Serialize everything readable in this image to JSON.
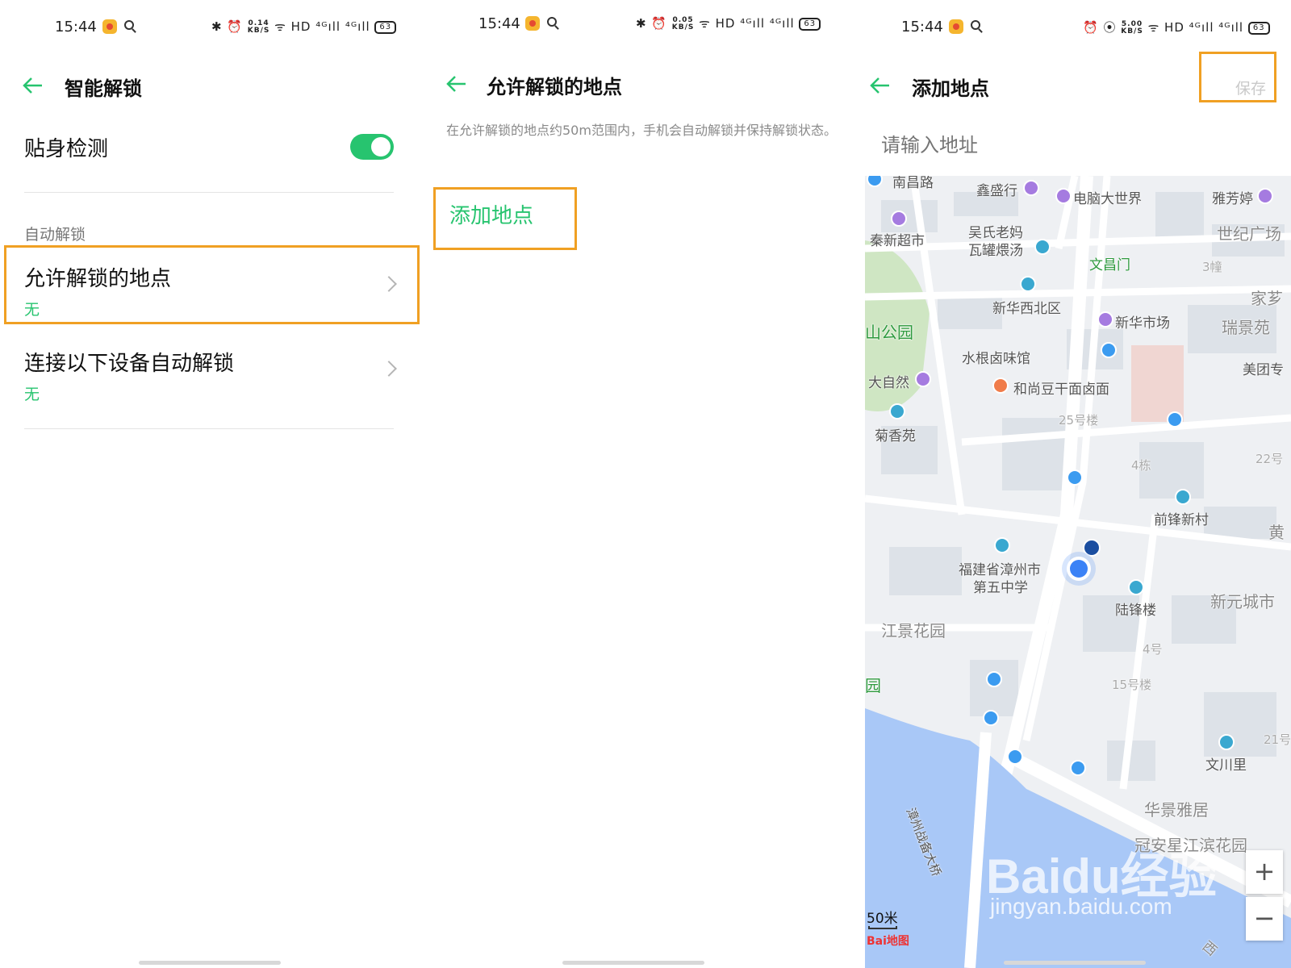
{
  "colors": {
    "accent": "#27c46f",
    "highlight": "#f0a023"
  },
  "status": {
    "p1": {
      "time": "15:44",
      "speed": "0.14",
      "unit": "KB/S",
      "battery": "63"
    },
    "p2": {
      "time": "15:44",
      "speed": "0.05",
      "unit": "KB/S",
      "battery": "63"
    },
    "p3": {
      "time": "15:44",
      "speed": "5.00",
      "unit": "KB/S",
      "battery": "63"
    }
  },
  "screen1": {
    "title": "智能解锁",
    "body_detection": "贴身检测",
    "body_detection_on": true,
    "section": "自动解锁",
    "items": [
      {
        "title": "允许解锁的地点",
        "value": "无"
      },
      {
        "title": "连接以下设备自动解锁",
        "value": "无"
      }
    ]
  },
  "screen2": {
    "title": "允许解锁的地点",
    "description": "在允许解锁的地点约50m范围内，手机会自动解锁并保持解锁状态。",
    "add_label": "添加地点"
  },
  "screen3": {
    "title": "添加地点",
    "save_label": "保存",
    "address_placeholder": "请输入地址",
    "map": {
      "scale": "50米",
      "logo": "Bai地图",
      "watermark": "Baidu经验",
      "watermark_url": "jingyan.baidu.com",
      "zoom_in": "+",
      "zoom_out": "−",
      "pois": [
        "南昌路",
        "鑫盛行",
        "电脑大世界",
        "雅芳婷",
        "秦新超市",
        "吴氏老妈",
        "瓦罐煨汤",
        "世纪广场",
        "文昌门",
        "3幢",
        "家芗",
        "新华西北区",
        "新华市场",
        "瑞景苑",
        "山公园",
        "水根卤味馆",
        "美团专",
        "大自然",
        "和尚豆干面卤面",
        "25号楼",
        "菊香苑",
        "4栋",
        "22号",
        "前锋新村",
        "黄",
        "福建省漳州市",
        "第五中学",
        "陆锋楼",
        "新元城市",
        "江景花园",
        "4号",
        "15号楼",
        "园",
        "21号",
        "文川里",
        "漳州战备大桥",
        "华景雅居",
        "冠安星江滨花园",
        "西"
      ]
    }
  }
}
